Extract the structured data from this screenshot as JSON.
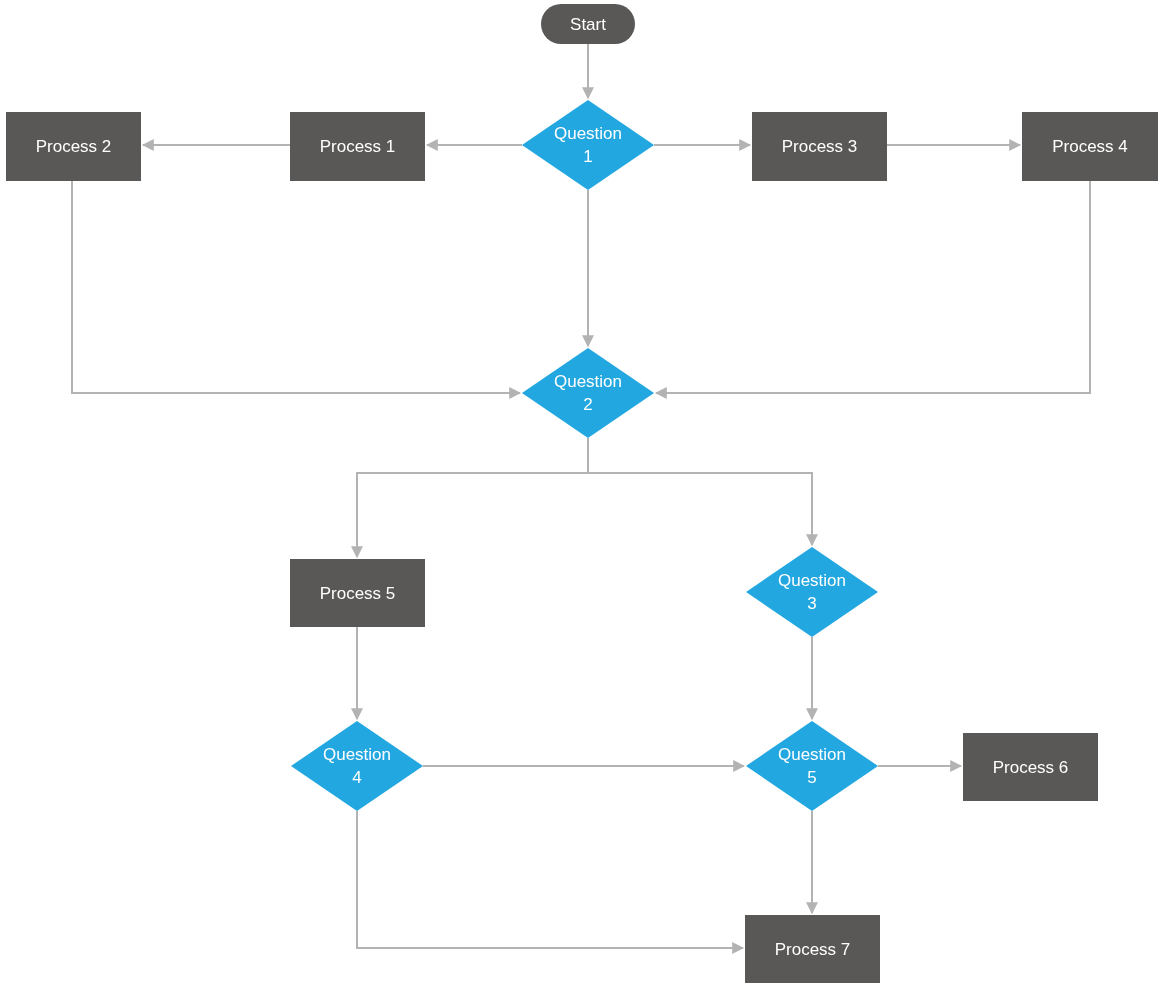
{
  "flowchart": {
    "nodes": [
      {
        "kind": "terminal",
        "label": "Start"
      },
      {
        "kind": "process",
        "label": "Process 2"
      },
      {
        "kind": "process",
        "label": "Process 1"
      },
      {
        "kind": "decision",
        "label": "Question 1"
      },
      {
        "kind": "process",
        "label": "Process 3"
      },
      {
        "kind": "process",
        "label": "Process 4"
      },
      {
        "kind": "decision",
        "label": "Question 2"
      },
      {
        "kind": "process",
        "label": "Process 5"
      },
      {
        "kind": "decision",
        "label": "Question 3"
      },
      {
        "kind": "decision",
        "label": "Question 4"
      },
      {
        "kind": "decision",
        "label": "Question 5"
      },
      {
        "kind": "process",
        "label": "Process 6"
      },
      {
        "kind": "process",
        "label": "Process 7"
      }
    ]
  }
}
